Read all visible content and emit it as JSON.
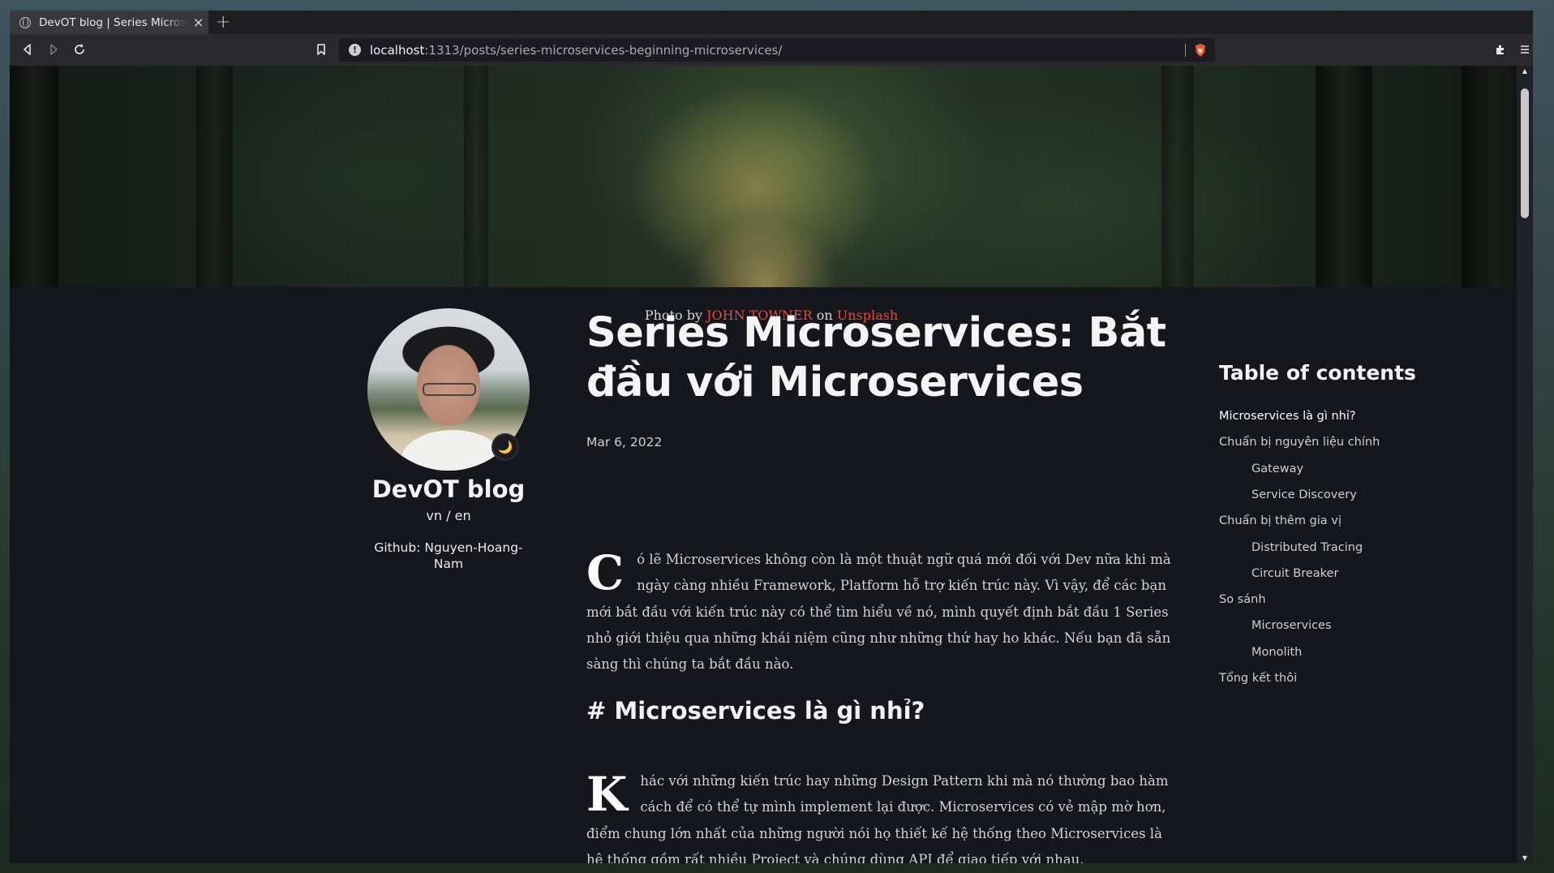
{
  "browser": {
    "tab_title": "DevOT blog | Series Microservices: Bắt đầu với Microservices",
    "tab_close": "×",
    "new_tab": "+",
    "url_host": "localhost",
    "url_path": ":1313/posts/series-microservices-beginning-microservices/",
    "info_glyph": "!"
  },
  "hero": {
    "caption_prefix": "Photo by ",
    "photographer": "JOHN TOWNER",
    "caption_mid": " on ",
    "source": "Unsplash"
  },
  "profile": {
    "blog_title": "DevOT blog",
    "lang_vn": "vn",
    "lang_sep": " / ",
    "lang_en": "en",
    "github": "Github: Nguyen-Hoang-Nam",
    "theme_toggle_glyph": "🌙"
  },
  "post": {
    "title": "Series Microservices: Bắt đầu với Microservices",
    "date": "Mar 6, 2022",
    "intro_dropcap": "C",
    "intro_text": "ó lẽ Microservices không còn là một thuật ngữ quá mới đối với Dev nữa khi mà ngày càng nhiều Framework, Platform hỗ trợ kiến trúc này. Vì vậy, để các bạn mới bắt đầu với kiến trúc này có thể tìm hiểu về nó, mình quyết định bắt đầu 1 Series nhỏ giới thiệu qua những khái niệm cũng như những thứ hay ho khác. Nếu bạn đã sẵn sàng thì chúng ta bắt đầu nào.",
    "section1_heading": "# Microservices là gì nhỉ?",
    "section1_dropcap": "K",
    "section1_text": "hác với những kiến trúc hay những Design Pattern khi mà nó thường bao hàm cách để có thể tự mình implement lại được. Microservices có vẻ mập mờ hơn, điểm chung lớn nhất của những người nói họ thiết kế hệ thống theo Microservices là hệ thống gồm rất nhiều Project và chúng dùng API để giao tiếp với nhau."
  },
  "toc": {
    "title": "Table of contents",
    "items": [
      {
        "label": "Microservices là gì nhỉ?",
        "level": 1,
        "active": true
      },
      {
        "label": "Chuẩn bị nguyên liệu chính",
        "level": 1
      },
      {
        "label": "Gateway",
        "level": 2
      },
      {
        "label": "Service Discovery",
        "level": 2
      },
      {
        "label": "Chuẩn bị thêm gia vị",
        "level": 1
      },
      {
        "label": "Distributed Tracing",
        "level": 2
      },
      {
        "label": "Circuit Breaker",
        "level": 2
      },
      {
        "label": "So sánh",
        "level": 1
      },
      {
        "label": "Microservices",
        "level": 2
      },
      {
        "label": "Monolith",
        "level": 2
      },
      {
        "label": "Tổng kết thôi",
        "level": 1
      }
    ]
  },
  "colors": {
    "accent_link": "#e84a3a",
    "page_bg": "#15171c"
  }
}
